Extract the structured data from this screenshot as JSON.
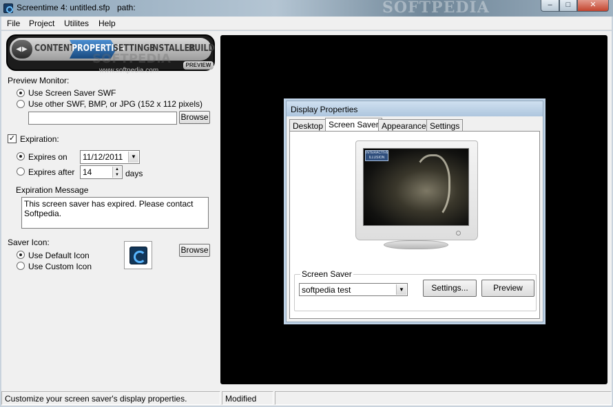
{
  "window": {
    "title": "Screentime 4: untitled.sfp",
    "path_label": "path:",
    "titlebar_watermark": "SOFTPEDIA",
    "buttons": {
      "minimize": "‒",
      "maximize": "□",
      "close": "✕"
    }
  },
  "menu": [
    "File",
    "Project",
    "Utilites",
    "Help"
  ],
  "nav": {
    "arrows": "◀▶",
    "tabs": [
      "CONTENT",
      "PROPERTIES",
      "SETTINGS",
      "INSTALLER",
      "BUILD"
    ],
    "active_tab": "PROPERTIES",
    "preview_label": "PREVIEW",
    "watermark": "SOFTPEDIA",
    "watermark_url": "www.softpedia.com"
  },
  "preview_monitor": {
    "label": "Preview Monitor:",
    "option_swf": "Use Screen Saver SWF",
    "option_other": "Use other SWF, BMP, or JPG  (152 x 112 pixels)",
    "file_value": "",
    "browse_label": "Browse",
    "selected": "swf"
  },
  "expiration": {
    "checkbox_label": "Expiration:",
    "checked": true,
    "expires_on_label": "Expires on",
    "expires_on_value": "11/12/2011",
    "expires_after_label": "Expires after",
    "expires_after_value": "14",
    "days_label": "days",
    "message_label": "Expiration Message",
    "message_value": "This screen saver has expired. Please contact Softpedia."
  },
  "saver_icon": {
    "label": "Saver Icon:",
    "option_default": "Use Default Icon",
    "option_custom": "Use Custom Icon",
    "browse_label": "Browse"
  },
  "display_properties": {
    "title": "Display Properties",
    "tabs": [
      "Desktop",
      "Screen Saver",
      "Appearance",
      "Settings"
    ],
    "active_tab": "Screen Saver",
    "screen_logo": "INTERACTIVE ILLUSION",
    "group_label": "Screen Saver",
    "saver_value": "softpedia test",
    "settings_button": "Settings...",
    "preview_button": "Preview"
  },
  "status": {
    "message": "Customize your screen saver's display properties.",
    "state": "Modified",
    "extra": ""
  },
  "colors": {
    "monitor_bg": "#000000",
    "nav_active": "#1f5a96",
    "window_bg": "#f0f0f0"
  }
}
